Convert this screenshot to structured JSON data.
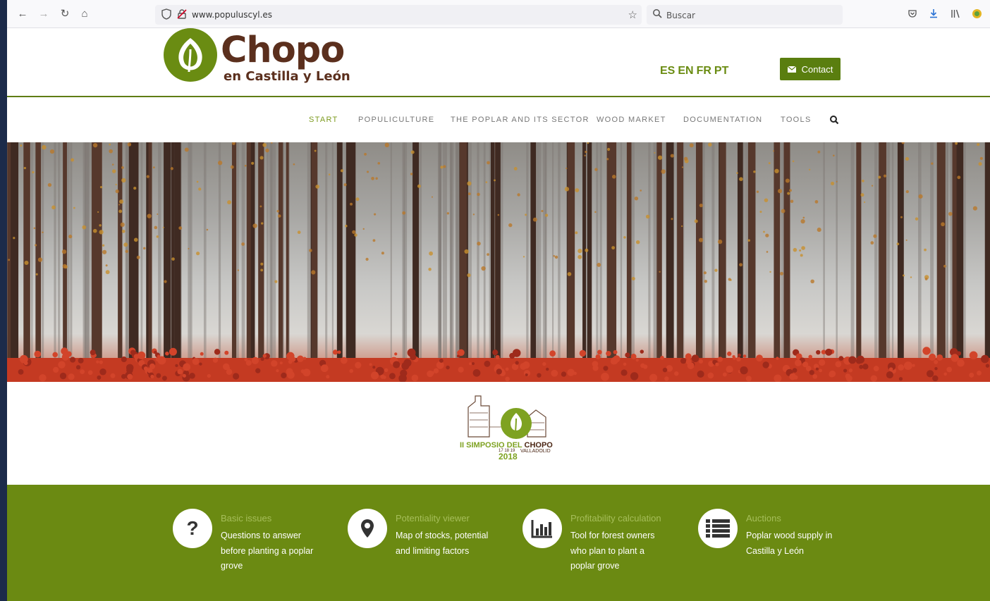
{
  "browser": {
    "url": "www.populuscyl.es",
    "search_placeholder": "Buscar"
  },
  "header": {
    "logo_title": "Chopo",
    "logo_subtitle": "en Castilla y León",
    "languages": [
      "ES",
      "EN",
      "FR",
      "PT"
    ],
    "contact_label": "Contact"
  },
  "nav": {
    "items": [
      {
        "label": "START",
        "active": true
      },
      {
        "label": "POPULICULTURE"
      },
      {
        "label": "THE POPLAR AND ITS SECTOR"
      },
      {
        "label": "WOOD MARKET"
      },
      {
        "label": "DOCUMENTATION"
      },
      {
        "label": "TOOLS"
      }
    ]
  },
  "event": {
    "title_green": "II SIMPOSIO DEL",
    "title_dark": "CHOPO",
    "dates": "17 18 19",
    "city": "VALLADOLID",
    "year": "2018"
  },
  "features": [
    {
      "icon": "question-icon",
      "title": "Basic issues",
      "desc": "Questions to answer before planting a poplar grove"
    },
    {
      "icon": "map-marker-icon",
      "title": "Potentiality viewer",
      "desc": "Map of stocks, potential and limiting factors"
    },
    {
      "icon": "bar-chart-icon",
      "title": "Profitability calculation",
      "desc": "Tool for forest owners who plan to plant a poplar grove"
    },
    {
      "icon": "list-icon",
      "title": "Auctions",
      "desc": "Poplar wood supply in Castilla y León"
    }
  ],
  "colors": {
    "brand_green": "#6b8a12",
    "brand_brown": "#5b2f1d",
    "nav_active": "#7c9a1e"
  }
}
